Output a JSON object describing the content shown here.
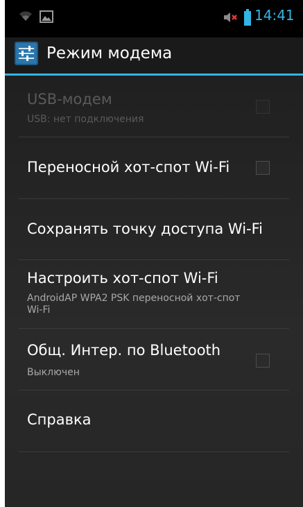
{
  "status_bar": {
    "time": "14:41",
    "icons": [
      "wifi-icon",
      "picture-icon",
      "mute-icon",
      "battery-icon"
    ]
  },
  "action_bar": {
    "title": "Режим модема",
    "icon": "settings-icon"
  },
  "settings": {
    "items": [
      {
        "label": "USB-модем",
        "summary": "USB: нет подключения",
        "enabled": false,
        "has_checkbox": true,
        "checked": false
      },
      {
        "label": "Переносной хот-спот Wi-Fi",
        "summary": "",
        "enabled": true,
        "has_checkbox": true,
        "checked": false
      },
      {
        "label": "Сохранять точку доступа Wi-Fi",
        "summary": "",
        "enabled": true,
        "has_checkbox": false
      },
      {
        "label": "Настроить хот-спот Wi-Fi",
        "summary": "AndroidAP WPA2 PSK переносной хот-спот Wi-Fi",
        "enabled": true,
        "has_checkbox": false
      },
      {
        "label": "Общ. Интер. по Bluetooth",
        "summary": "Выключен",
        "enabled": true,
        "has_checkbox": true,
        "checked": false
      },
      {
        "label": "Справка",
        "summary": "",
        "enabled": true,
        "has_checkbox": false
      }
    ]
  },
  "colors": {
    "accent": "#33b5e5",
    "mute": "#e53935",
    "battery": "#33b5e5"
  }
}
